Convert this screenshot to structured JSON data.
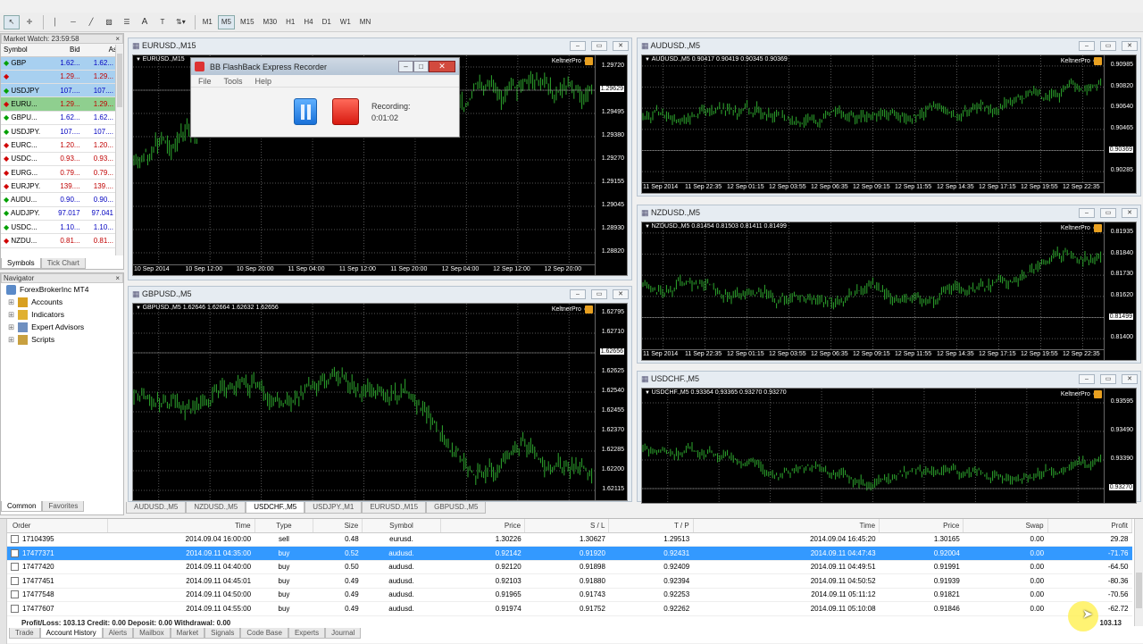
{
  "toolbar": {
    "timeframes": [
      "M1",
      "M5",
      "M15",
      "M30",
      "H1",
      "H4",
      "D1",
      "W1",
      "MN"
    ],
    "active_timeframe": "M5"
  },
  "market_watch": {
    "title": "Market Watch: 23:59:58",
    "headers": [
      "Symbol",
      "Bid",
      "Ask"
    ],
    "rows": [
      {
        "symbol": "GBP",
        "bid": "1.62...",
        "ask": "1.62...",
        "dir": "up",
        "style": "blue"
      },
      {
        "symbol": "",
        "bid": "1.29...",
        "ask": "1.29...",
        "dir": "down",
        "style": "blue"
      },
      {
        "symbol": "USDJPY",
        "bid": "107....",
        "ask": "107....",
        "dir": "up",
        "style": "blue"
      },
      {
        "symbol": "EURU...",
        "bid": "1.29...",
        "ask": "1.29...",
        "dir": "down",
        "style": "green"
      },
      {
        "symbol": "GBPU...",
        "bid": "1.62...",
        "ask": "1.62...",
        "dir": "up",
        "style": "plain"
      },
      {
        "symbol": "USDJPY.",
        "bid": "107....",
        "ask": "107....",
        "dir": "up",
        "style": "plain"
      },
      {
        "symbol": "EURC...",
        "bid": "1.20...",
        "ask": "1.20...",
        "dir": "down",
        "style": "plain"
      },
      {
        "symbol": "USDC...",
        "bid": "0.93...",
        "ask": "0.93...",
        "dir": "down",
        "style": "plain"
      },
      {
        "symbol": "EURG...",
        "bid": "0.79...",
        "ask": "0.79...",
        "dir": "down",
        "style": "plain"
      },
      {
        "symbol": "EURJPY.",
        "bid": "139....",
        "ask": "139....",
        "dir": "down",
        "style": "plain"
      },
      {
        "symbol": "AUDU...",
        "bid": "0.90...",
        "ask": "0.90...",
        "dir": "up",
        "style": "plain"
      },
      {
        "symbol": "AUDJPY.",
        "bid": "97.017",
        "ask": "97.041",
        "dir": "up",
        "style": "plain"
      },
      {
        "symbol": "USDC...",
        "bid": "1.10...",
        "ask": "1.10...",
        "dir": "up",
        "style": "plain"
      },
      {
        "symbol": "NZDU...",
        "bid": "0.81...",
        "ask": "0.81...",
        "dir": "down",
        "style": "plain"
      }
    ],
    "tabs": [
      "Symbols",
      "Tick Chart"
    ],
    "active_tab": "Symbols"
  },
  "navigator": {
    "title": "Navigator",
    "root": "ForexBrokerInc MT4",
    "items": [
      "Accounts",
      "Indicators",
      "Expert Advisors",
      "Scripts"
    ],
    "tabs": [
      "Common",
      "Favorites"
    ],
    "active_tab": "Common"
  },
  "recorder": {
    "title": "BB FlashBack Express Recorder",
    "menu": [
      "File",
      "Tools",
      "Help"
    ],
    "status_label": "Recording:",
    "elapsed": "0:01:02"
  },
  "charts": [
    {
      "window_title": "EURUSD.,M15",
      "label": "EURUSD.,M15",
      "indicator": "KeltnerPro",
      "prices": [
        "1.29720",
        "1.29629",
        "1.29495",
        "1.29380",
        "1.29270",
        "1.29155",
        "1.29045",
        "1.28930",
        "1.28820"
      ],
      "current_price": "1.29629",
      "current_index": 1,
      "times": [
        "10 Sep 2014",
        "10 Sep 12:00",
        "10 Sep 20:00",
        "11 Sep 04:00",
        "11 Sep 12:00",
        "11 Sep 20:00",
        "12 Sep 04:00",
        "12 Sep 12:00",
        "12 Sep 20:00"
      ]
    },
    {
      "window_title": "GBPUSD.,M5",
      "label": "GBPUSD.,M5  1.62646 1.62664 1.62632 1.62656",
      "indicator": "KeltnerPro",
      "prices": [
        "1.62795",
        "1.62710",
        "1.62656",
        "1.62625",
        "1.62540",
        "1.62455",
        "1.62370",
        "1.62285",
        "1.62200",
        "1.62115"
      ],
      "current_price": "1.62656",
      "current_index": 2,
      "times": []
    },
    {
      "window_title": "AUDUSD.,M5",
      "label": "AUDUSD.,M5  0.90417 0.90419 0.90345 0.90369",
      "indicator": "KeltnerPro",
      "prices": [
        "0.90985",
        "0.90820",
        "0.90640",
        "0.90465",
        "0.90369",
        "0.90285"
      ],
      "current_price": "0.90369",
      "current_index": 4,
      "times": [
        "11 Sep 2014",
        "11 Sep 22:35",
        "12 Sep 01:15",
        "12 Sep 03:55",
        "12 Sep 06:35",
        "12 Sep 09:15",
        "12 Sep 11:55",
        "12 Sep 14:35",
        "12 Sep 17:15",
        "12 Sep 19:55",
        "12 Sep 22:35"
      ]
    },
    {
      "window_title": "NZDUSD.,M5",
      "label": "NZDUSD.,M5  0.81454 0.81503 0.81411 0.81499",
      "indicator": "KeltnerPro",
      "prices": [
        "0.81935",
        "0.81840",
        "0.81730",
        "0.81620",
        "0.81499",
        "0.81400"
      ],
      "current_price": "0.81499",
      "current_index": 4,
      "times": [
        "11 Sep 2014",
        "11 Sep 22:35",
        "12 Sep 01:15",
        "12 Sep 03:55",
        "12 Sep 06:35",
        "12 Sep 09:15",
        "12 Sep 11:55",
        "12 Sep 14:35",
        "12 Sep 17:15",
        "12 Sep 19:55",
        "12 Sep 22:35"
      ]
    },
    {
      "window_title": "USDCHF.,M5",
      "label": "USDCHF.,M5  0.93364 0.93365 0.93270 0.93270",
      "indicator": "KeltnerPro",
      "prices": [
        "0.93595",
        "0.93490",
        "0.93390",
        "0.93270"
      ],
      "current_price": "0.93270",
      "current_index": 3,
      "times": []
    }
  ],
  "chart_tabs": [
    "AUDUSD.,M5",
    "NZDUSD.,M5",
    "USDCHF.,M5",
    "USDJPY.,M1",
    "EURUSD.,M15",
    "GBPUSD.,M5"
  ],
  "active_chart_tab": "USDCHF.,M5",
  "terminal": {
    "headers": [
      "Order",
      "Time",
      "Type",
      "Size",
      "Symbol",
      "Price",
      "S / L",
      "T / P",
      "Time",
      "Price",
      "Swap",
      "Profit"
    ],
    "rows": [
      {
        "order": "17104395",
        "time": "2014.09.04 16:00:00",
        "type": "sell",
        "size": "0.48",
        "symbol": "eurusd.",
        "price": "1.30226",
        "sl": "1.30627",
        "tp": "1.29513",
        "close_time": "2014.09.04 16:45:20",
        "close_price": "1.30165",
        "swap": "0.00",
        "profit": "29.28"
      },
      {
        "order": "17477371",
        "time": "2014.09.11 04:35:00",
        "type": "buy",
        "size": "0.52",
        "symbol": "audusd.",
        "price": "0.92142",
        "sl": "0.91920",
        "tp": "0.92431",
        "close_time": "2014.09.11 04:47:43",
        "close_price": "0.92004",
        "swap": "0.00",
        "profit": "-71.76",
        "selected": true
      },
      {
        "order": "17477420",
        "time": "2014.09.11 04:40:00",
        "type": "buy",
        "size": "0.50",
        "symbol": "audusd.",
        "price": "0.92120",
        "sl": "0.91898",
        "tp": "0.92409",
        "close_time": "2014.09.11 04:49:51",
        "close_price": "0.91991",
        "swap": "0.00",
        "profit": "-64.50"
      },
      {
        "order": "17477451",
        "time": "2014.09.11 04:45:01",
        "type": "buy",
        "size": "0.49",
        "symbol": "audusd.",
        "price": "0.92103",
        "sl": "0.91880",
        "tp": "0.92394",
        "close_time": "2014.09.11 04:50:52",
        "close_price": "0.91939",
        "swap": "0.00",
        "profit": "-80.36"
      },
      {
        "order": "17477548",
        "time": "2014.09.11 04:50:00",
        "type": "buy",
        "size": "0.49",
        "symbol": "audusd.",
        "price": "0.91965",
        "sl": "0.91743",
        "tp": "0.92253",
        "close_time": "2014.09.11 05:11:12",
        "close_price": "0.91821",
        "swap": "0.00",
        "profit": "-70.56"
      },
      {
        "order": "17477607",
        "time": "2014.09.11 04:55:00",
        "type": "buy",
        "size": "0.49",
        "symbol": "audusd.",
        "price": "0.91974",
        "sl": "0.91752",
        "tp": "0.92262",
        "close_time": "2014.09.11 05:10:08",
        "close_price": "0.91846",
        "swap": "0.00",
        "profit": "-62.72"
      }
    ],
    "summary": "Profit/Loss: 103.13  Credit: 0.00  Deposit: 0.00  Withdrawal: 0.00",
    "summary_total": "103.13",
    "tabs": [
      "Trade",
      "Account History",
      "Alerts",
      "Mailbox",
      "Market",
      "Signals",
      "Code Base",
      "Experts",
      "Journal"
    ],
    "active_tab": "Account History"
  },
  "colors": {
    "candle": "#2ea82e",
    "chart_bg": "#000000",
    "selected_row": "#3399ff",
    "market_green": "#8fcf8f"
  }
}
